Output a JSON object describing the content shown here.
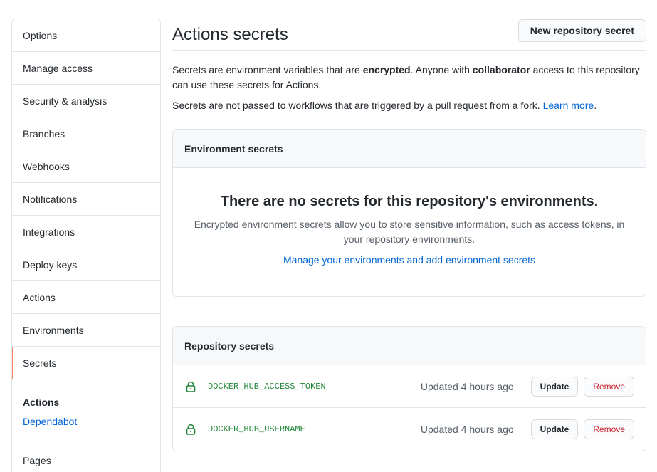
{
  "sidebar": {
    "items": [
      {
        "label": "Options"
      },
      {
        "label": "Manage access"
      },
      {
        "label": "Security & analysis"
      },
      {
        "label": "Branches"
      },
      {
        "label": "Webhooks"
      },
      {
        "label": "Notifications"
      },
      {
        "label": "Integrations"
      },
      {
        "label": "Deploy keys"
      },
      {
        "label": "Actions"
      },
      {
        "label": "Environments"
      },
      {
        "label": "Secrets",
        "selected": true
      }
    ],
    "group": {
      "title": "Actions",
      "link": "Dependabot"
    },
    "after": [
      {
        "label": "Pages"
      }
    ]
  },
  "main": {
    "title": "Actions secrets",
    "new_button": "New repository secret",
    "desc_part1": "Secrets are environment variables that are ",
    "desc_bold1": "encrypted",
    "desc_part2": ". Anyone with ",
    "desc_bold2": "collaborator",
    "desc_part3": " access to this repository can use these secrets for Actions.",
    "desc2_text": "Secrets are not passed to workflows that are triggered by a pull request from a fork. ",
    "desc2_link": "Learn more",
    "desc2_end": "."
  },
  "env_secrets": {
    "header": "Environment secrets",
    "blank_title": "There are no secrets for this repository's environments.",
    "blank_desc": "Encrypted environment secrets allow you to store sensitive information, such as access tokens, in your repository environments.",
    "blank_link": "Manage your environments and add environment secrets"
  },
  "repo_secrets": {
    "header": "Repository secrets",
    "rows": [
      {
        "name": "DOCKER_HUB_ACCESS_TOKEN",
        "updated": "Updated 4 hours ago",
        "update_label": "Update",
        "remove_label": "Remove"
      },
      {
        "name": "DOCKER_HUB_USERNAME",
        "updated": "Updated 4 hours ago",
        "update_label": "Update",
        "remove_label": "Remove"
      }
    ]
  },
  "colors": {
    "accent": "#0366d6",
    "secret_name": "#22863a",
    "danger": "#cb2431",
    "selected_bar": "#f9826c"
  },
  "icons": {
    "secret": "lock-icon"
  }
}
